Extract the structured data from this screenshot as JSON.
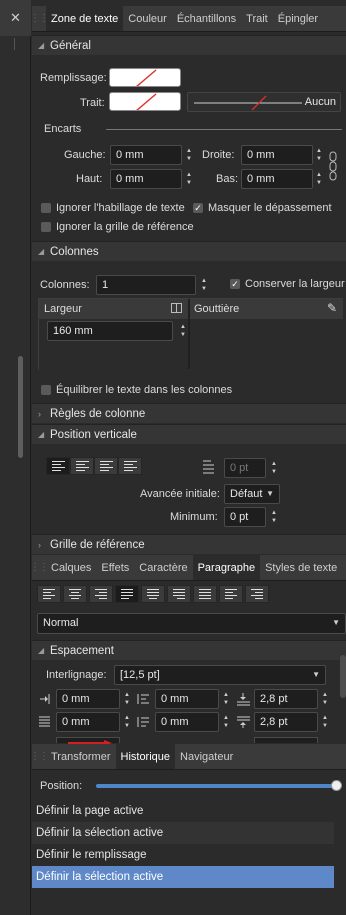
{
  "colors": {
    "panel_bg": "#2b2b2b",
    "tab_bg": "#3a3a3a",
    "selection": "#5f88c9",
    "field_bg": "#1e1e1e"
  },
  "close_glyph": "✕",
  "top_tabs": [
    "Zone de texte",
    "Couleur",
    "Échantillons",
    "Trait",
    "Épingler"
  ],
  "general": {
    "title": "Général",
    "remplissage_label": "Remplissage:",
    "trait_label": "Trait:",
    "aucun": "Aucun",
    "encarts": "Encarts",
    "gauche_label": "Gauche:",
    "gauche_value": "0 mm",
    "droite_label": "Droite:",
    "droite_value": "0 mm",
    "haut_label": "Haut:",
    "haut_value": "0 mm",
    "bas_label": "Bas:",
    "bas_value": "0 mm",
    "ignore_wrap": "Ignorer l'habillage de texte",
    "hide_overflow": "Masquer le dépassement",
    "ignore_grid": "Ignorer la grille de référence"
  },
  "colonnes": {
    "title": "Colonnes",
    "count_label": "Colonnes:",
    "count_value": "1",
    "keep_width": "Conserver la largeur",
    "col_header_width": "Largeur",
    "col_header_gutter": "Gouttière",
    "width_value": "160 mm",
    "balance": "Équilibrer le texte dans les colonnes"
  },
  "regles": {
    "title": "Règles de colonne"
  },
  "position": {
    "title": "Position verticale",
    "offset_value": "0 pt",
    "avance_label": "Avancée initiale:",
    "avance_value": "Défaut",
    "minimum_label": "Minimum:",
    "minimum_value": "0 pt"
  },
  "grille": {
    "title": "Grille de référence"
  },
  "mid_tabs": [
    "Calques",
    "Effets",
    "Caractère",
    "Paragraphe",
    "Styles de texte"
  ],
  "paragraph_style": "Normal",
  "espacement": {
    "title": "Espacement",
    "interlignage_label": "Interlignage:",
    "interlignage_value": "[12,5 pt]",
    "r1": [
      "0 mm",
      "0 mm",
      "2,8 pt"
    ],
    "r2": [
      "0 mm",
      "0 mm",
      "2,8 pt"
    ]
  },
  "bottom_tabs": [
    "Transformer",
    "Historique",
    "Navigateur"
  ],
  "historique": {
    "position_label": "Position:",
    "position_value": 1.0,
    "items": [
      "Définir la page active",
      "Définir la sélection active",
      "Définir le remplissage",
      "Définir la sélection active"
    ]
  }
}
